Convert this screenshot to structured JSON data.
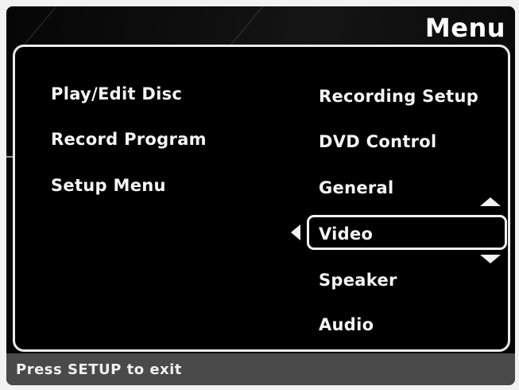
{
  "header": {
    "title": "Menu"
  },
  "left_menu": {
    "items": [
      {
        "label": "Play/Edit Disc"
      },
      {
        "label": "Record Program"
      },
      {
        "label": "Setup Menu"
      }
    ]
  },
  "right_menu": {
    "items": [
      {
        "label": "Recording Setup"
      },
      {
        "label": "DVD Control"
      },
      {
        "label": "General"
      },
      {
        "label": "Video"
      },
      {
        "label": "Speaker"
      },
      {
        "label": "Audio"
      }
    ],
    "selected_index": 3
  },
  "status_bar": {
    "text": "Press SETUP to exit"
  },
  "colors": {
    "background": "#050505",
    "text": "#f5f5f5",
    "status_bar": "#4a4a4a",
    "border": "#eaeaea"
  },
  "icons": {
    "selection_pointer": "triangle-left-icon",
    "scroll_up": "triangle-up-icon",
    "scroll_down": "triangle-down-icon"
  }
}
